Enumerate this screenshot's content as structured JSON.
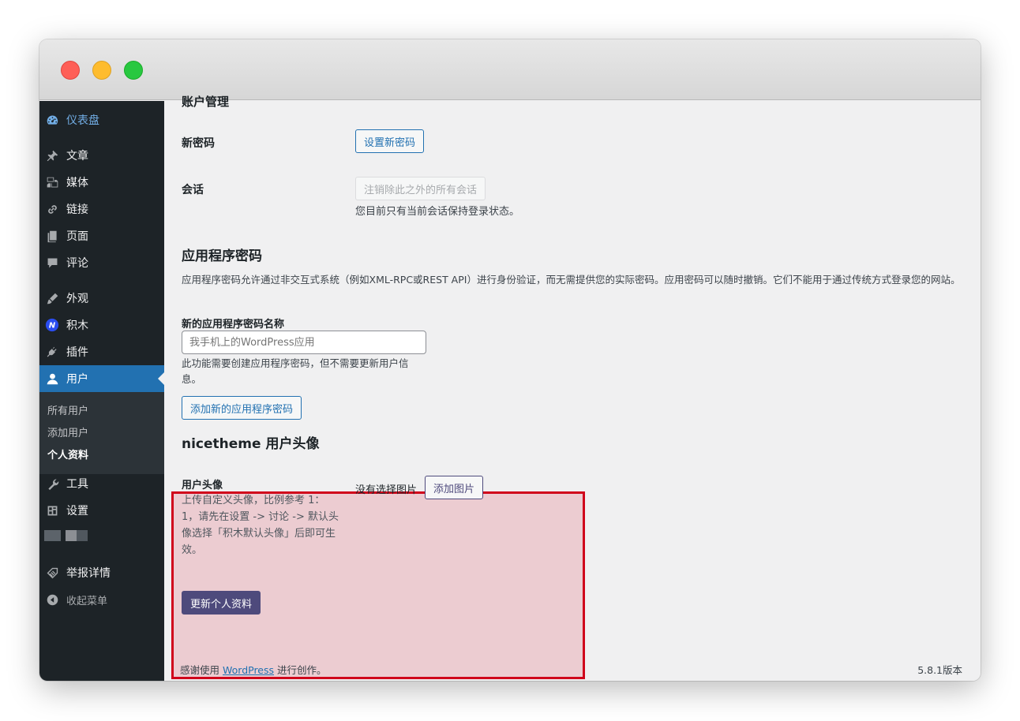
{
  "sidebar": {
    "items": [
      {
        "label": "仪表盘",
        "icon": "dashboard-icon"
      },
      {
        "label": "文章",
        "icon": "pin-icon"
      },
      {
        "label": "媒体",
        "icon": "media-icon"
      },
      {
        "label": "链接",
        "icon": "link-icon"
      },
      {
        "label": "页面",
        "icon": "page-icon"
      },
      {
        "label": "评论",
        "icon": "comment-icon"
      },
      {
        "label": "外观",
        "icon": "brush-icon"
      },
      {
        "label": "积木",
        "icon": "jimu-icon"
      },
      {
        "label": "插件",
        "icon": "plugin-icon"
      },
      {
        "label": "用户",
        "icon": "user-icon"
      },
      {
        "label": "工具",
        "icon": "wrench-icon"
      },
      {
        "label": "设置",
        "icon": "settings-icon"
      },
      {
        "label": "举报详情",
        "icon": "tag-icon"
      },
      {
        "label": "收起菜单",
        "icon": "collapse-icon"
      }
    ],
    "submenu": [
      "所有用户",
      "添加用户",
      "个人资料"
    ]
  },
  "content": {
    "cut_heading": "账户管理",
    "new_password": {
      "label": "新密码",
      "button": "设置新密码"
    },
    "sessions": {
      "label": "会话",
      "button": "注销除此之外的所有会话",
      "note": "您目前只有当前会话保持登录状态。"
    },
    "app_passwords": {
      "title": "应用程序密码",
      "description": "应用程序密码允许通过非交互式系统（例如XML-RPC或REST API）进行身份验证，而无需提供您的实际密码。应用密码可以随时撤销。它们不能用于通过传统方式登录您的网站。",
      "name_label": "新的应用程序密码名称",
      "name_placeholder": "我手机上的WordPress应用",
      "hint": "此功能需要创建应用程序密码，但不需要更新用户信息。",
      "add_button": "添加新的应用程序密码"
    },
    "avatar": {
      "section_title": "nicetheme 用户头像",
      "label": "用户头像",
      "description": "上传自定义头像，比例参考 1：1，请先在设置 -> 讨论 -> 默认头像选择「积木默认头像」后即可生效。",
      "no_image": "没有选择图片",
      "add_image": "添加图片"
    },
    "update_button": "更新个人资料"
  },
  "footer": {
    "thanks_prefix": "感谢使用",
    "link": "WordPress",
    "thanks_suffix": "进行创作。",
    "version": "5.8.1版本"
  },
  "colors": {
    "sidebar_bg": "#1d2327",
    "active": "#2271b1",
    "primary_button": "#4e4a7c",
    "highlight_border": "#d0021b"
  }
}
